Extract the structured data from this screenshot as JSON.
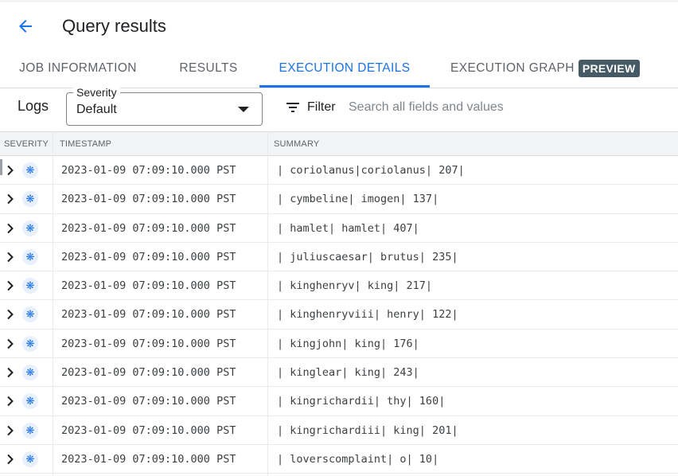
{
  "header": {
    "title": "Query results",
    "back_icon": "arrow-back-icon"
  },
  "tabs": [
    {
      "label": "JOB INFORMATION",
      "active": false
    },
    {
      "label": "RESULTS",
      "active": false
    },
    {
      "label": "EXECUTION DETAILS",
      "active": true
    },
    {
      "label": "EXECUTION GRAPH",
      "active": false,
      "badge": "PREVIEW"
    }
  ],
  "toolbar": {
    "logs_label": "Logs",
    "severity": {
      "legend": "Severity",
      "value": "Default"
    },
    "filter_label": "Filter",
    "search_placeholder": "Search all fields and values"
  },
  "table": {
    "columns": [
      "SEVERITY",
      "TIMESTAMP",
      "SUMMARY"
    ],
    "rows": [
      {
        "timestamp": "2023-01-09 07:09:10.000 PST",
        "summary": "| coriolanus|coriolanus| 207|"
      },
      {
        "timestamp": "2023-01-09 07:09:10.000 PST",
        "summary": "| cymbeline| imogen| 137|"
      },
      {
        "timestamp": "2023-01-09 07:09:10.000 PST",
        "summary": "| hamlet| hamlet| 407|"
      },
      {
        "timestamp": "2023-01-09 07:09:10.000 PST",
        "summary": "| juliuscaesar| brutus| 235|"
      },
      {
        "timestamp": "2023-01-09 07:09:10.000 PST",
        "summary": "| kinghenryv| king| 217|"
      },
      {
        "timestamp": "2023-01-09 07:09:10.000 PST",
        "summary": "| kinghenryviii| henry| 122|"
      },
      {
        "timestamp": "2023-01-09 07:09:10.000 PST",
        "summary": "| kingjohn| king| 176|"
      },
      {
        "timestamp": "2023-01-09 07:09:10.000 PST",
        "summary": "| kinglear| king| 243|"
      },
      {
        "timestamp": "2023-01-09 07:09:10.000 PST",
        "summary": "| kingrichardii| thy| 160|"
      },
      {
        "timestamp": "2023-01-09 07:09:10.000 PST",
        "summary": "| kingrichardiii| king| 201|"
      },
      {
        "timestamp": "2023-01-09 07:09:10.000 PST",
        "summary": "| loverscomplaint| o| 10|"
      }
    ]
  },
  "colors": {
    "accent": "#1a73e8",
    "badge_bg": "#455a64",
    "severity_icon_bg": "#e8f0fe"
  }
}
